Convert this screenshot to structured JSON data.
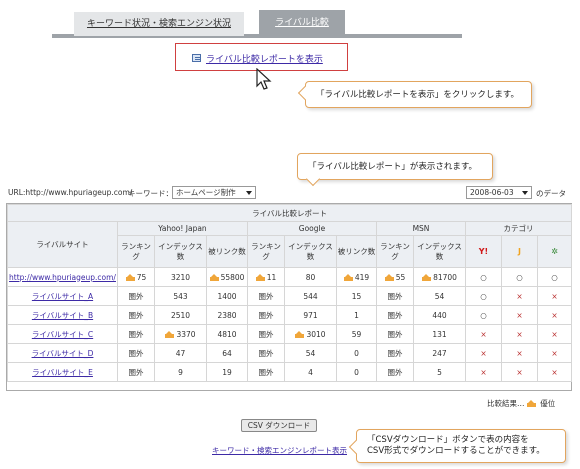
{
  "tabs": [
    {
      "label": "キーワード状況・検索エンジン状況"
    },
    {
      "label": "ライバル比較"
    }
  ],
  "show_report_link": "ライバル比較レポートを表示",
  "callouts": {
    "click": "「ライバル比較レポートを表示」をクリックします。",
    "shown": "「ライバル比較レポート」が表示されます。",
    "csv_line1": "「CSVダウンロード」ボタンで表の内容を",
    "csv_line2": "CSV形式でダウンロードすることができます。"
  },
  "meta": {
    "url_label": "URL:http://www.hpuriageup.com/",
    "keyword_label": "キーワード：",
    "keyword_value": "ホームページ制作",
    "date_value": "2008-06-03",
    "date_suffix": "のデータ"
  },
  "table": {
    "title": "ライバル比較レポート",
    "site_header": "ライバルサイト",
    "engines": [
      "Yahoo! Japan",
      "Google",
      "MSN"
    ],
    "category_header": "カテゴリ",
    "sub_headers": [
      "ランキング",
      "インデックス数",
      "被リンク数"
    ],
    "msn_sub_headers": [
      "ランキング",
      "インデックス数"
    ],
    "category_icons": [
      "yahoo-icon",
      "goo-icon",
      "msn-icon"
    ],
    "rows": [
      {
        "site": "http://www.hpuriageup.com/",
        "y_rank": "75",
        "y_rank_best": true,
        "y_index": "3210",
        "y_index_best": false,
        "y_link": "55800",
        "y_link_best": true,
        "g_rank": "11",
        "g_rank_best": true,
        "g_index": "80",
        "g_index_best": false,
        "g_link": "419",
        "g_link_best": true,
        "m_rank": "55",
        "m_rank_best": true,
        "m_index": "81700",
        "m_index_best": true,
        "cat": [
          "○",
          "○",
          "○"
        ]
      },
      {
        "site": "ライバルサイト_A",
        "y_rank": "圏外",
        "y_index": "543",
        "y_link": "1400",
        "g_rank": "圏外",
        "g_index": "544",
        "g_link": "15",
        "m_rank": "圏外",
        "m_index": "54",
        "cat": [
          "○",
          "×",
          "×"
        ]
      },
      {
        "site": "ライバルサイト_B",
        "y_rank": "圏外",
        "y_index": "2510",
        "y_link": "2380",
        "g_rank": "圏外",
        "g_index": "971",
        "g_link": "1",
        "m_rank": "圏外",
        "m_index": "440",
        "cat": [
          "○",
          "×",
          "×"
        ]
      },
      {
        "site": "ライバルサイト_C",
        "y_rank": "圏外",
        "y_index": "3370",
        "y_index_best": true,
        "y_link": "4810",
        "g_rank": "圏外",
        "g_index": "3010",
        "g_index_best": true,
        "g_link": "59",
        "m_rank": "圏外",
        "m_index": "131",
        "cat": [
          "×",
          "×",
          "×"
        ]
      },
      {
        "site": "ライバルサイト_D",
        "y_rank": "圏外",
        "y_index": "47",
        "y_link": "64",
        "g_rank": "圏外",
        "g_index": "54",
        "g_link": "0",
        "m_rank": "圏外",
        "m_index": "247",
        "cat": [
          "×",
          "×",
          "×"
        ]
      },
      {
        "site": "ライバルサイト_E",
        "y_rank": "圏外",
        "y_index": "9",
        "y_link": "19",
        "g_rank": "圏外",
        "g_index": "4",
        "g_link": "0",
        "m_rank": "圏外",
        "m_index": "5",
        "cat": [
          "×",
          "×",
          "×"
        ]
      }
    ]
  },
  "legend": {
    "prefix": "比較結果…",
    "suffix": "優位"
  },
  "csv_button": "CSV ダウンロード",
  "keyword_report_link": "キーワード・検索エンジンレポート表示"
}
